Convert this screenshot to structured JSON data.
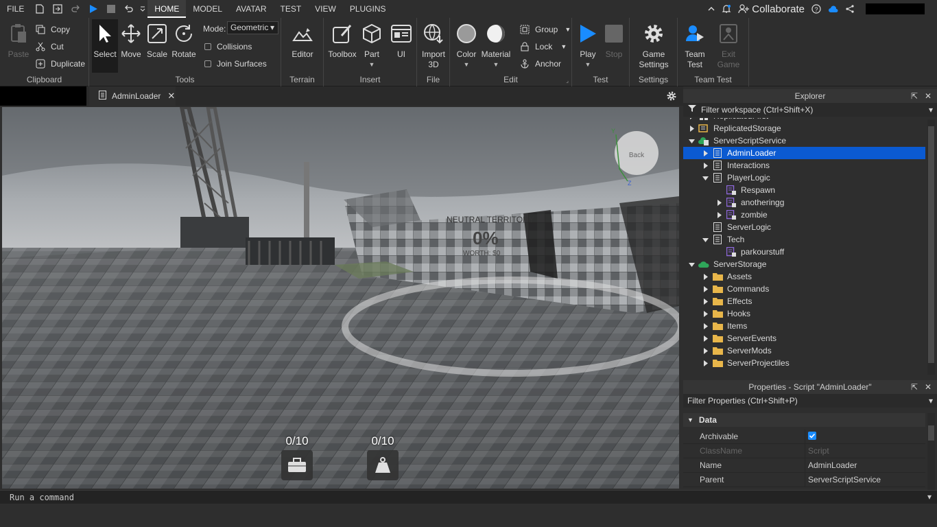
{
  "menubar": {
    "file": "FILE",
    "tabs": [
      "HOME",
      "MODEL",
      "AVATAR",
      "TEST",
      "VIEW",
      "PLUGINS"
    ],
    "collaborate": "Collaborate"
  },
  "ribbon": {
    "clipboard": {
      "paste": "Paste",
      "copy": "Copy",
      "cut": "Cut",
      "duplicate": "Duplicate",
      "label": "Clipboard"
    },
    "tools": {
      "select": "Select",
      "move": "Move",
      "scale": "Scale",
      "rotate": "Rotate",
      "mode_label": "Mode:",
      "mode_value": "Geometric",
      "collisions": "Collisions",
      "join_surfaces": "Join Surfaces",
      "label": "Tools"
    },
    "terrain": {
      "editor": "Editor",
      "label": "Terrain"
    },
    "insert": {
      "toolbox": "Toolbox",
      "part": "Part",
      "ui": "UI",
      "label": "Insert"
    },
    "file": {
      "import3d_1": "Import",
      "import3d_2": "3D",
      "label": "File"
    },
    "edit": {
      "color": "Color",
      "material": "Material",
      "group": "Group",
      "lock": "Lock",
      "anchor": "Anchor",
      "label": "Edit"
    },
    "test": {
      "play": "Play",
      "stop": "Stop",
      "label": "Test"
    },
    "settings": {
      "game_settings_1": "Game",
      "game_settings_2": "Settings",
      "label": "Settings"
    },
    "team_test": {
      "team_test_1": "Team",
      "team_test_2": "Test",
      "exit_game_1": "Exit",
      "exit_game_2": "Game",
      "label": "Team Test"
    }
  },
  "doc_tab": {
    "title": "AdminLoader"
  },
  "viewport": {
    "counter_left": "0/10",
    "counter_right": "0/10",
    "sign_line1": "NEUTRAL TERRITORY",
    "sign_line2": "0%",
    "sign_line3": "WORTH: $0",
    "view_cube": "Back",
    "axis_y": "Y",
    "axis_z": "Z"
  },
  "explorer": {
    "title": "Explorer",
    "filter": "Filter workspace (Ctrl+Shift+X)",
    "items": [
      {
        "label": "ReplicatedFirst",
        "depth": 0,
        "arrow": "right",
        "icon": "replicated-first"
      },
      {
        "label": "ReplicatedStorage",
        "depth": 0,
        "arrow": "right",
        "icon": "replicated-storage"
      },
      {
        "label": "ServerScriptService",
        "depth": 0,
        "arrow": "down",
        "icon": "server-script-service"
      },
      {
        "label": "AdminLoader",
        "depth": 1,
        "arrow": "right",
        "icon": "script",
        "selected": true
      },
      {
        "label": "Interactions",
        "depth": 1,
        "arrow": "right",
        "icon": "script"
      },
      {
        "label": "PlayerLogic",
        "depth": 1,
        "arrow": "down",
        "icon": "script"
      },
      {
        "label": "Respawn",
        "depth": 2,
        "arrow": "none",
        "icon": "module-script"
      },
      {
        "label": "anotheringg",
        "depth": 2,
        "arrow": "right",
        "icon": "module-script"
      },
      {
        "label": "zombie",
        "depth": 2,
        "arrow": "right",
        "icon": "module-script"
      },
      {
        "label": "ServerLogic",
        "depth": 1,
        "arrow": "none",
        "icon": "script"
      },
      {
        "label": "Tech",
        "depth": 1,
        "arrow": "down",
        "icon": "script"
      },
      {
        "label": "parkourstuff",
        "depth": 2,
        "arrow": "none",
        "icon": "module-script"
      },
      {
        "label": "ServerStorage",
        "depth": 0,
        "arrow": "down",
        "icon": "server-storage"
      },
      {
        "label": "Assets",
        "depth": 1,
        "arrow": "right",
        "icon": "folder"
      },
      {
        "label": "Commands",
        "depth": 1,
        "arrow": "right",
        "icon": "folder"
      },
      {
        "label": "Effects",
        "depth": 1,
        "arrow": "right",
        "icon": "folder"
      },
      {
        "label": "Hooks",
        "depth": 1,
        "arrow": "right",
        "icon": "folder"
      },
      {
        "label": "Items",
        "depth": 1,
        "arrow": "right",
        "icon": "folder"
      },
      {
        "label": "ServerEvents",
        "depth": 1,
        "arrow": "right",
        "icon": "folder"
      },
      {
        "label": "ServerMods",
        "depth": 1,
        "arrow": "right",
        "icon": "folder"
      },
      {
        "label": "ServerProjectiles",
        "depth": 1,
        "arrow": "right",
        "icon": "folder"
      }
    ]
  },
  "properties": {
    "title": "Properties - Script \"AdminLoader\"",
    "filter": "Filter Properties (Ctrl+Shift+P)",
    "section": "Data",
    "rows": [
      {
        "name": "Archivable",
        "value": "",
        "checkbox": true,
        "dim": false
      },
      {
        "name": "ClassName",
        "value": "Script",
        "dim": true
      },
      {
        "name": "Name",
        "value": "AdminLoader",
        "dim": false
      },
      {
        "name": "Parent",
        "value": "ServerScriptService",
        "dim": false
      }
    ]
  },
  "command_bar": {
    "placeholder": "Run a command"
  },
  "colors": {
    "accent": "#0b5ad1",
    "play": "#1a8cff",
    "folder": "#e8b64a",
    "module": "#8b66d6",
    "service_green": "#2fa65a"
  }
}
